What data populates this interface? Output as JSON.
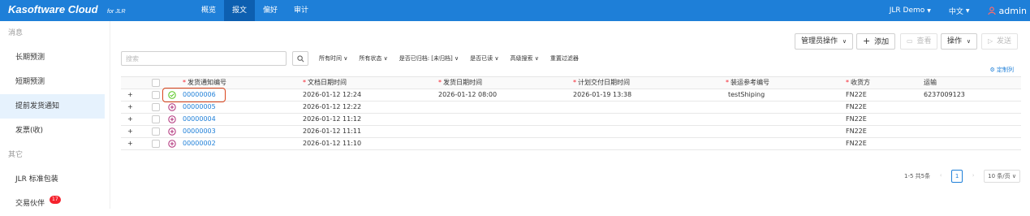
{
  "brand": {
    "name": "Kasoftware Cloud",
    "sub": "for JLR"
  },
  "nav": [
    {
      "label": "概览"
    },
    {
      "label": "报文"
    },
    {
      "label": "偏好"
    },
    {
      "label": "审计"
    }
  ],
  "top_right": {
    "workspace": "JLR Demo",
    "language": "中文",
    "user": "admin"
  },
  "sidebar": {
    "groups": [
      {
        "label": "消息",
        "items": [
          {
            "label": "长期预测"
          },
          {
            "label": "短期预测"
          },
          {
            "label": "提前发货通知"
          },
          {
            "label": "发票(收)"
          }
        ]
      },
      {
        "label": "其它",
        "items": [
          {
            "label": "JLR 标准包装"
          },
          {
            "label": "交易伙伴",
            "badge": "17"
          }
        ]
      }
    ]
  },
  "toolbar": {
    "admin_ops": "管理员操作",
    "add": "添加",
    "view": "查看",
    "ops": "操作",
    "send": "发送"
  },
  "search": {
    "placeholder": "搜索"
  },
  "filters": [
    {
      "label": "所有时间"
    },
    {
      "label": "所有状态"
    },
    {
      "label": "是否已归档: [未归档]"
    },
    {
      "label": "是否已读"
    },
    {
      "label": "高级搜索"
    },
    {
      "label": "重置过滤器"
    }
  ],
  "customize": "定制列",
  "table": {
    "columns": [
      {
        "label": "发货通知编号",
        "required": true
      },
      {
        "label": "文档日期时间",
        "required": true
      },
      {
        "label": "发货日期时间",
        "required": true
      },
      {
        "label": "计划交付日期时间",
        "required": true
      },
      {
        "label": "装运参考编号",
        "required": true
      },
      {
        "label": "收货方",
        "required": true
      },
      {
        "label": "运输",
        "required": false
      }
    ],
    "rows": [
      {
        "status": "sent",
        "number": "00000006",
        "doc_date": "2026-01-12 12:24",
        "ship_date": "2026-01-12 08:00",
        "delivery_date": "2026-01-19 13:38",
        "ship_ref": "testShiping",
        "receiver": "FN22E",
        "transport": "6237009123"
      },
      {
        "status": "draft",
        "number": "00000005",
        "doc_date": "2026-01-12 12:22",
        "ship_date": "",
        "delivery_date": "",
        "ship_ref": "",
        "receiver": "FN22E",
        "transport": ""
      },
      {
        "status": "draft",
        "number": "00000004",
        "doc_date": "2026-01-12 11:12",
        "ship_date": "",
        "delivery_date": "",
        "ship_ref": "",
        "receiver": "FN22E",
        "transport": ""
      },
      {
        "status": "draft",
        "number": "00000003",
        "doc_date": "2026-01-12 11:11",
        "ship_date": "",
        "delivery_date": "",
        "ship_ref": "",
        "receiver": "FN22E",
        "transport": ""
      },
      {
        "status": "draft",
        "number": "00000002",
        "doc_date": "2026-01-12 11:10",
        "ship_date": "",
        "delivery_date": "",
        "ship_ref": "",
        "receiver": "FN22E",
        "transport": ""
      }
    ]
  },
  "pager": {
    "summary": "1-5 共5条",
    "current_page": "1",
    "page_size": "10 条/页"
  },
  "colors": {
    "topbar": "#1e7fd8",
    "nav_active": "#0d5fb0",
    "link": "#1e7fd8",
    "sent": "#52c41a",
    "draft": "#b0307a",
    "highlight": "#d9441c"
  }
}
